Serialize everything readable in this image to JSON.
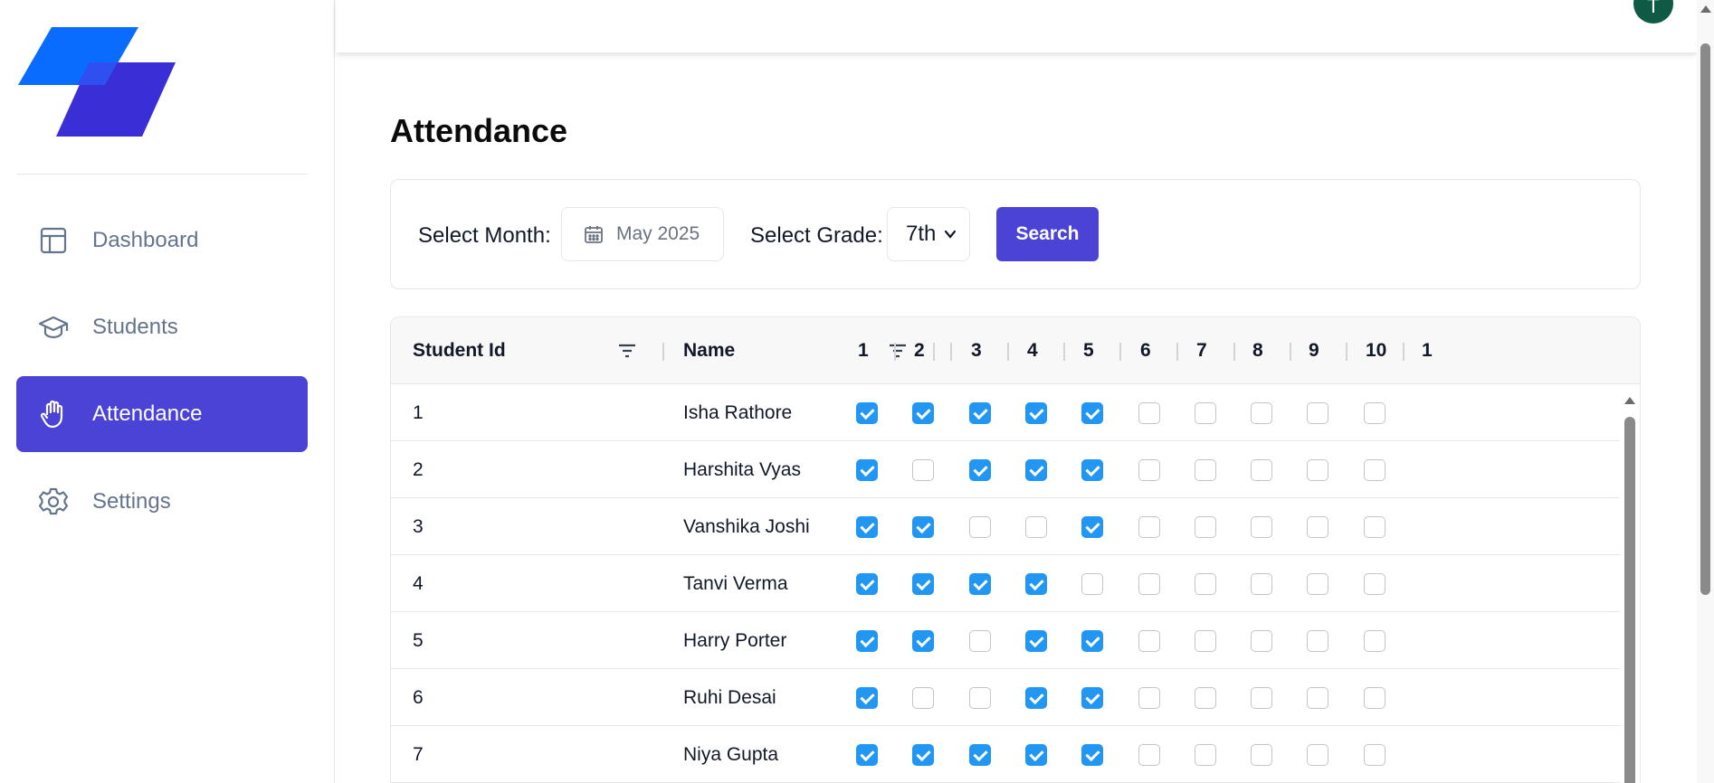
{
  "brand": {
    "logo_color_1": "#0a6cff",
    "logo_color_2": "#3a2fd6"
  },
  "sidebar": {
    "items": [
      {
        "label": "Dashboard",
        "icon": "layout-icon",
        "active": false
      },
      {
        "label": "Students",
        "icon": "graduation-cap-icon",
        "active": false
      },
      {
        "label": "Attendance",
        "icon": "hand-icon",
        "active": true
      },
      {
        "label": "Settings",
        "icon": "gear-icon",
        "active": false
      }
    ]
  },
  "header": {
    "avatar_initial": "T"
  },
  "page": {
    "title": "Attendance"
  },
  "filters": {
    "month_label": "Select Month:",
    "month_value": "May 2025",
    "grade_label": "Select Grade:",
    "grade_value": "7th",
    "search_label": "Search"
  },
  "table": {
    "columns": [
      "Student Id",
      "Name",
      "1",
      "2",
      "3",
      "4",
      "5",
      "6",
      "7",
      "8",
      "9",
      "10",
      "1"
    ],
    "rows": [
      {
        "id": "1",
        "name": "Isha Rathore",
        "days": [
          true,
          true,
          true,
          true,
          true,
          false,
          false,
          false,
          false,
          false
        ]
      },
      {
        "id": "2",
        "name": "Harshita Vyas",
        "days": [
          true,
          false,
          true,
          true,
          true,
          false,
          false,
          false,
          false,
          false
        ]
      },
      {
        "id": "3",
        "name": "Vanshika Joshi",
        "days": [
          true,
          true,
          false,
          false,
          true,
          false,
          false,
          false,
          false,
          false
        ]
      },
      {
        "id": "4",
        "name": "Tanvi Verma",
        "days": [
          true,
          true,
          true,
          true,
          false,
          false,
          false,
          false,
          false,
          false
        ]
      },
      {
        "id": "5",
        "name": "Harry Porter",
        "days": [
          true,
          true,
          false,
          true,
          true,
          false,
          false,
          false,
          false,
          false
        ]
      },
      {
        "id": "6",
        "name": "Ruhi Desai",
        "days": [
          true,
          false,
          false,
          true,
          true,
          false,
          false,
          false,
          false,
          false
        ]
      },
      {
        "id": "7",
        "name": "Niya Gupta",
        "days": [
          true,
          true,
          true,
          true,
          true,
          false,
          false,
          false,
          false,
          false
        ]
      }
    ]
  },
  "colors": {
    "accent": "#4a43d6",
    "checkbox_on": "#2196f3",
    "avatar": "#0f5a45"
  }
}
